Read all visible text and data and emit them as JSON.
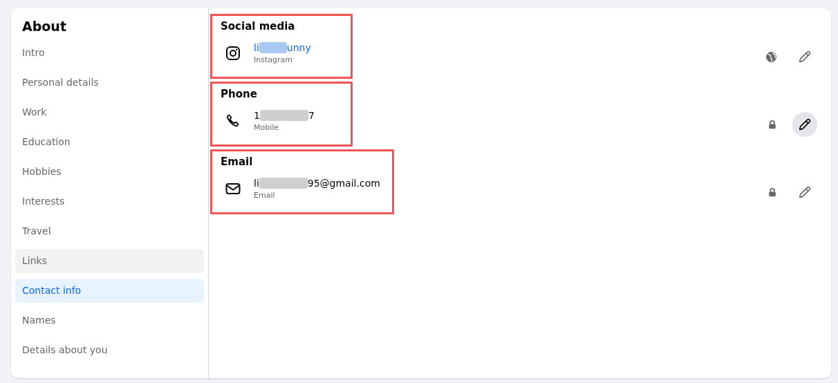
{
  "sidebar": {
    "title": "About",
    "items": [
      {
        "label": "Intro",
        "selected": false,
        "hovered": false
      },
      {
        "label": "Personal details",
        "selected": false,
        "hovered": false
      },
      {
        "label": "Work",
        "selected": false,
        "hovered": false
      },
      {
        "label": "Education",
        "selected": false,
        "hovered": false
      },
      {
        "label": "Hobbies",
        "selected": false,
        "hovered": false
      },
      {
        "label": "Interests",
        "selected": false,
        "hovered": false
      },
      {
        "label": "Travel",
        "selected": false,
        "hovered": false
      },
      {
        "label": "Links",
        "selected": false,
        "hovered": true
      },
      {
        "label": "Contact info",
        "selected": true,
        "hovered": false
      },
      {
        "label": "Names",
        "selected": false,
        "hovered": false
      },
      {
        "label": "Details about you",
        "selected": false,
        "hovered": false
      }
    ]
  },
  "sections": [
    {
      "heading": "Social media",
      "highlighted": true,
      "kind": "instagram",
      "value_start": "li",
      "value_end": "unny",
      "link": true,
      "sublabel": "Instagram",
      "private": false,
      "edit_hovered": false
    },
    {
      "heading": "Phone",
      "highlighted": true,
      "kind": "phone",
      "value_start": "1",
      "value_end": "7",
      "link": false,
      "sublabel": "Mobile",
      "private": true,
      "edit_hovered": true
    },
    {
      "heading": "Email",
      "highlighted": true,
      "kind": "email",
      "value_start": "li",
      "value_end": "95@gmail.com",
      "link": false,
      "sublabel": "Email",
      "private": true,
      "edit_hovered": false
    }
  ]
}
